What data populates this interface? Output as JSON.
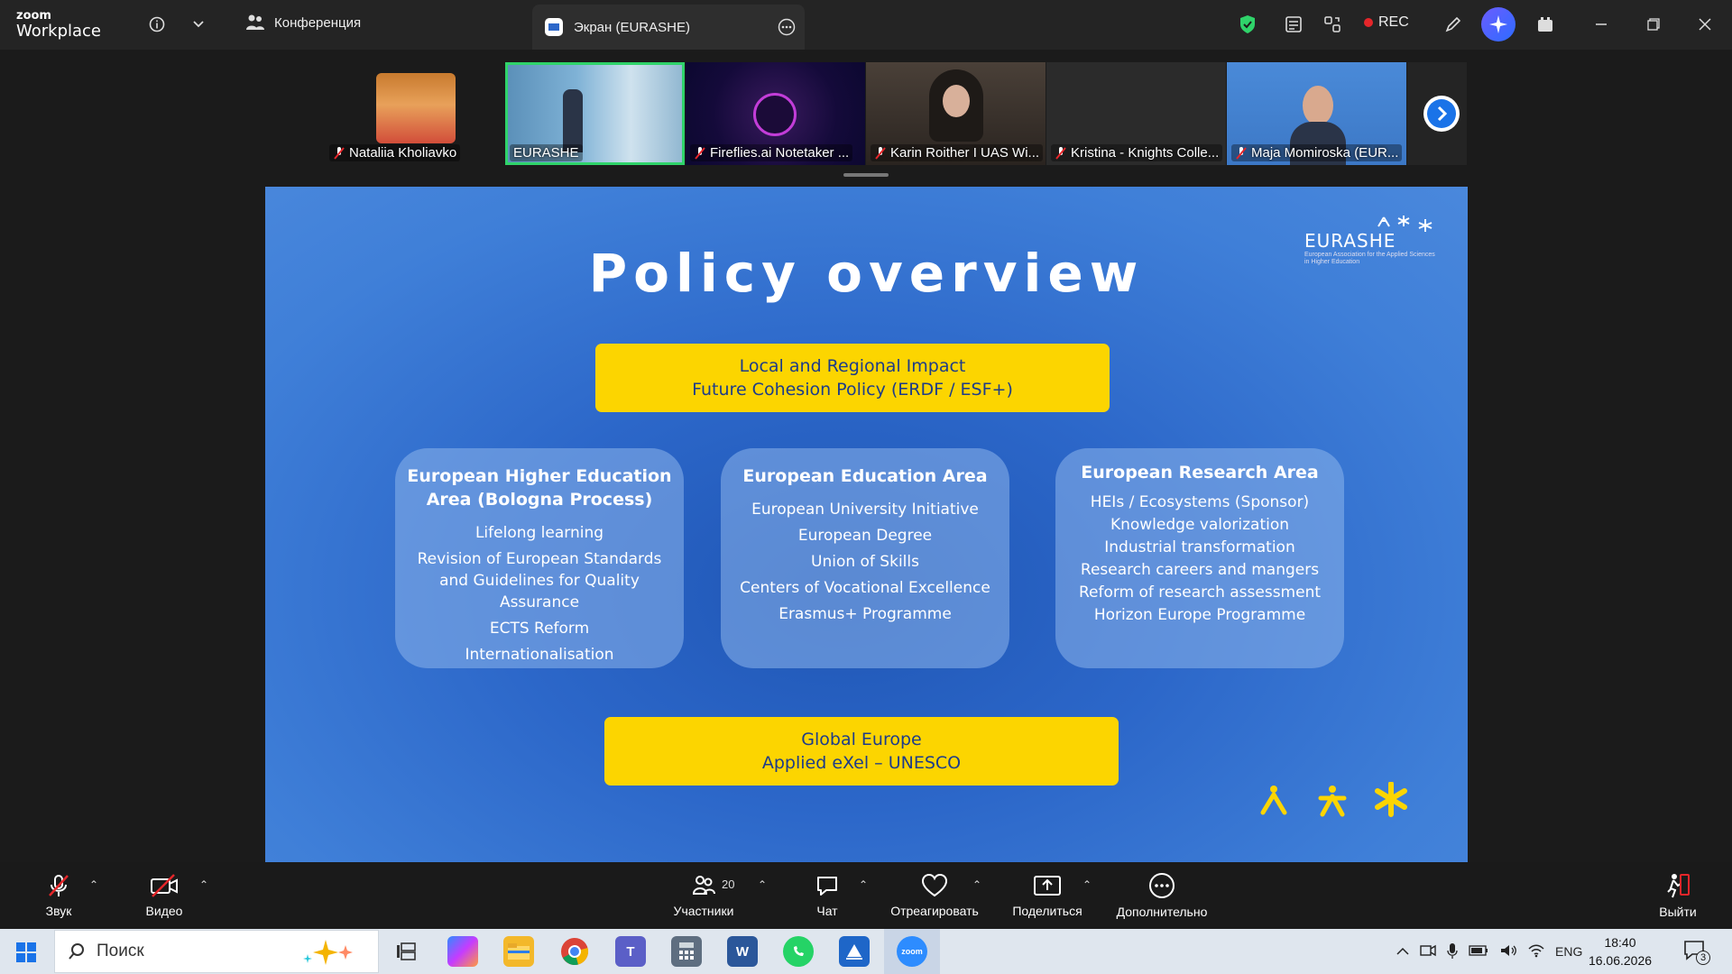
{
  "app": {
    "logo_line1": "zoom",
    "logo_line2": "Workplace"
  },
  "topbar": {
    "meeting_label": "Конференция",
    "share_tab": "Экран (EURASHE)",
    "rec_label": "REC",
    "status_color": "#2fd36a"
  },
  "participants": [
    {
      "name": "Nataliia Kholiavko",
      "muted": true
    },
    {
      "name": "EURASHE",
      "muted": false,
      "active": true
    },
    {
      "name": "Fireflies.ai Notetaker ...",
      "muted": true
    },
    {
      "name": "Karin Roither I UAS Wi...",
      "muted": true
    },
    {
      "name": "Kristina - Knights Colle...",
      "muted": true
    },
    {
      "name": "Maja Momiroska (EUR...",
      "muted": true
    }
  ],
  "slide": {
    "title": "Policy overview",
    "logo_text": "EURASHE",
    "logo_sub": "European Association for the Applied Sciences in Higher Education",
    "top_box": {
      "line1": "Local and Regional Impact",
      "line2": "Future Cohesion Policy (ERDF / ESF+)"
    },
    "cards": [
      {
        "title": "European Higher Education Area (Bologna Process)",
        "items": [
          "Lifelong learning",
          "Revision of European Standards and Guidelines for Quality Assurance",
          "ECTS Reform",
          "Internationalisation"
        ]
      },
      {
        "title": "European Education Area",
        "items": [
          "European University Initiative",
          "European Degree",
          "Union of Skills",
          "Centers of Vocational Excellence",
          "Erasmus+ Programme"
        ]
      },
      {
        "title": "European Research Area",
        "items": [
          "HEIs / Ecosystems (Sponsor)",
          "Knowledge valorization",
          "Industrial transformation",
          "Research careers and mangers",
          "Reform of research assessment",
          "Horizon Europe Programme"
        ]
      }
    ],
    "bottom_box": {
      "line1": "Global Europe",
      "line2": "Applied eXel – UNESCO"
    },
    "accent_color": "#fcd500"
  },
  "toolbar": {
    "audio": "Звук",
    "video": "Видео",
    "participants": "Участники",
    "participants_count": "20",
    "chat": "Чат",
    "react": "Отреагировать",
    "share": "Поделиться",
    "more": "Дополнительно",
    "leave": "Выйти"
  },
  "taskbar": {
    "search_placeholder": "Поиск",
    "lang": "ENG",
    "time": "18:40",
    "date": "16.06.2026",
    "notifications": "3"
  }
}
